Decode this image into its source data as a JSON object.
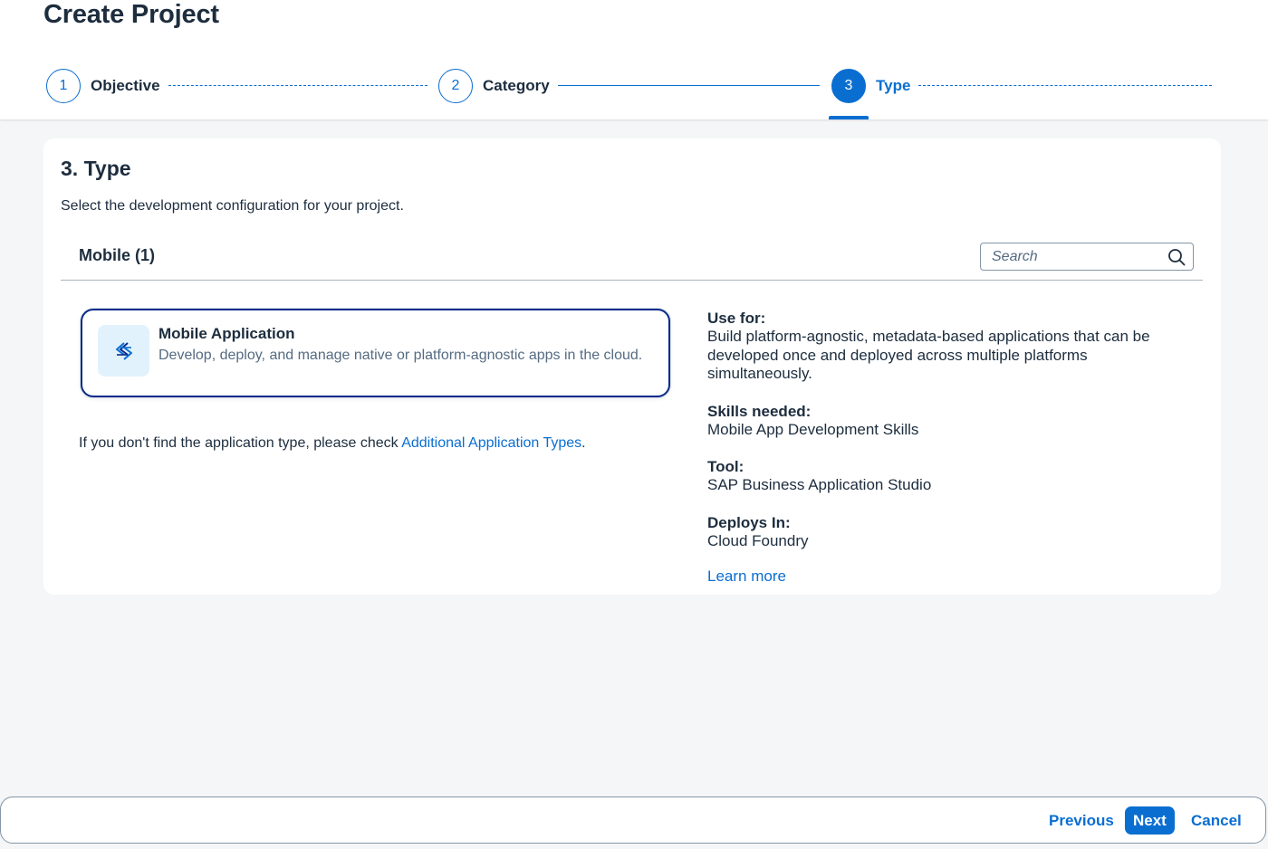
{
  "header": {
    "title": "Create Project",
    "steps": [
      {
        "number": "1",
        "label": "Objective",
        "state": "completed"
      },
      {
        "number": "2",
        "label": "Category",
        "state": "completed"
      },
      {
        "number": "3",
        "label": "Type",
        "state": "active"
      }
    ]
  },
  "main": {
    "section_title": "3. Type",
    "section_description": "Select the development configuration for your project.",
    "group_title": "Mobile (1)",
    "search": {
      "placeholder": "Search",
      "value": "",
      "icon": "search-icon"
    },
    "tile": {
      "icon": "mobile-app-icon",
      "title": "Mobile Application",
      "description": "Develop, deploy, and manage native or platform-agnostic apps in the cloud."
    },
    "hint": {
      "prefix": "If you don't find the application type, please check ",
      "link": "Additional Application Types",
      "suffix": "."
    },
    "details": {
      "use_for_label": "Use for:",
      "use_for_value": "Build platform-agnostic, metadata-based applications that can be developed once and deployed across multiple platforms simultaneously.",
      "skills_label": "Skills needed:",
      "skills_value": "Mobile App Development Skills",
      "tool_label": "Tool:",
      "tool_value": "SAP Business Application Studio",
      "deploys_label": "Deploys In:",
      "deploys_value": "Cloud Foundry",
      "learn_more": "Learn more"
    }
  },
  "footer": {
    "previous": "Previous",
    "next": "Next",
    "cancel": "Cancel"
  },
  "colors": {
    "accent": "#0a6ed1",
    "text": "#1d2d3e",
    "background": "#f5f6f7",
    "selected_border": "#0a2a8a"
  }
}
